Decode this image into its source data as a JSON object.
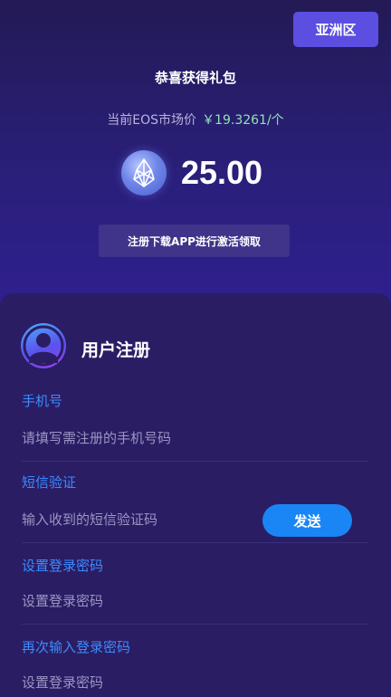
{
  "header": {
    "region_label": "亚洲区",
    "gift_title": "恭喜获得礼包",
    "price_label": "当前EOS市场价",
    "price_value": "￥19.3261/个",
    "amount": "25.00",
    "claim_label": "注册下载APP进行激活领取"
  },
  "form": {
    "title": "用户注册",
    "fields": [
      {
        "label": "手机号",
        "placeholder": "请填写需注册的手机号码"
      },
      {
        "label": "短信验证",
        "placeholder": "输入收到的短信验证码"
      },
      {
        "label": "设置登录密码",
        "placeholder": "设置登录密码"
      },
      {
        "label": "再次输入登录密码",
        "placeholder": "设置登录密码"
      }
    ],
    "send_label": "发送"
  },
  "colors": {
    "accent": "#5b4ee0",
    "label_blue": "#3d8bff",
    "send_button": "#1a86f5",
    "price_green": "#8fe3b5",
    "panel": "#2a1d63"
  },
  "icons": {
    "coin": "eos-icon",
    "avatar": "user-avatar-icon"
  }
}
